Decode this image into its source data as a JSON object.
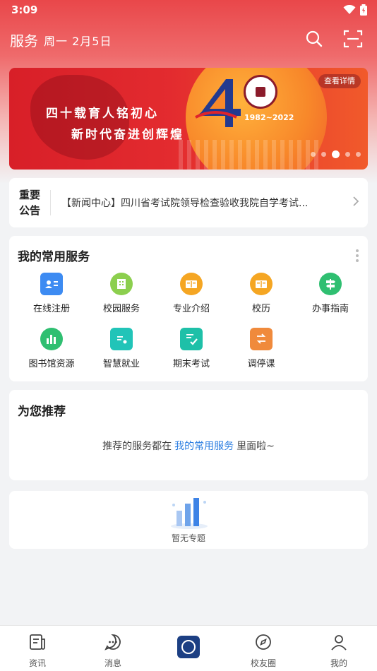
{
  "status_bar": {
    "time": "3:09"
  },
  "header": {
    "title": "服务",
    "date": "周一 2月5日"
  },
  "banner": {
    "slogan_line1": "四十载育人铭初心",
    "slogan_line2": "新时代奋进创辉煌",
    "years": "1982~2022",
    "detail_label": "查看详情",
    "slide_count": 5,
    "active_slide": 3
  },
  "notice": {
    "label": "重要公告",
    "text": "【新闻中心】四川省考试院领导检查验收我院自学考试..."
  },
  "services": {
    "title": "我的常用服务",
    "items": [
      {
        "label": "在线注册",
        "icon": "user-card-icon",
        "color": "#3d8bf2"
      },
      {
        "label": "校园服务",
        "icon": "building-icon",
        "color": "#8ccf4e"
      },
      {
        "label": "专业介绍",
        "icon": "book-icon",
        "color": "#f5a623"
      },
      {
        "label": "校历",
        "icon": "book-icon",
        "color": "#f5a623"
      },
      {
        "label": "办事指南",
        "icon": "signpost-icon",
        "color": "#2fbf71"
      },
      {
        "label": "图书馆资源",
        "icon": "chart-bars-icon",
        "color": "#2fbf71"
      },
      {
        "label": "智慧就业",
        "icon": "resume-icon",
        "color": "#21c4b8"
      },
      {
        "label": "期末考试",
        "icon": "exam-check-icon",
        "color": "#1ec0a8"
      },
      {
        "label": "调停课",
        "icon": "swap-class-icon",
        "color": "#f08a3c"
      }
    ]
  },
  "recommend": {
    "title": "为您推荐",
    "hint_prefix": "推荐的服务都在",
    "hint_link": "我的常用服务",
    "hint_suffix": "里面啦~"
  },
  "topics": {
    "empty_text": "暂无专题"
  },
  "tabbar": {
    "items": [
      {
        "label": "资讯",
        "icon": "news-icon"
      },
      {
        "label": "消息",
        "icon": "message-icon"
      },
      {
        "label": "",
        "icon": "school-logo-icon"
      },
      {
        "label": "校友圈",
        "icon": "compass-icon"
      },
      {
        "label": "我的",
        "icon": "person-icon"
      }
    ]
  }
}
